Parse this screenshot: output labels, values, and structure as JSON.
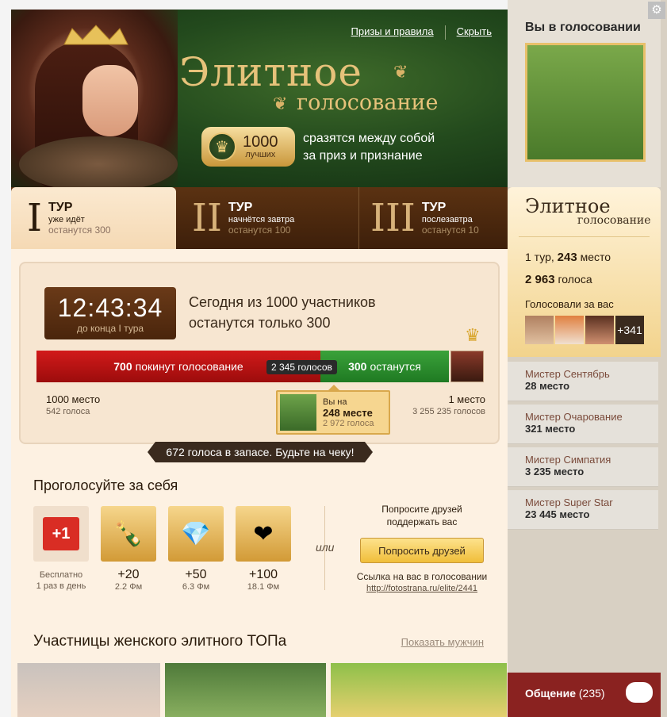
{
  "header": {
    "links": [
      "Призы и правила",
      "Скрыть"
    ],
    "logo_line1": "Элитное",
    "logo_line2": "голосование",
    "badge_num": "1000",
    "badge_sub": "лучших",
    "tagline1": "сразятся между собой",
    "tagline2": "за приз и признание"
  },
  "tours": [
    {
      "roman": "I",
      "title": "ТУР",
      "status": "уже идёт",
      "remain": "останутся 300"
    },
    {
      "roman": "II",
      "title": "ТУР",
      "status": "начнётся завтра",
      "remain": "останутся 100"
    },
    {
      "roman": "III",
      "title": "ТУР",
      "status": "послезавтра",
      "remain": "останутся 10"
    }
  ],
  "countdown": {
    "time": "12:43:34",
    "label": "до конца I тура",
    "text1": "Сегодня из 1000 участников",
    "text2": "останутся только 300"
  },
  "bar": {
    "left_num": "700",
    "left_text": "покинут голосование",
    "mid": "2 345 голосов",
    "right_num": "300",
    "right_text": "останутся",
    "red_fraction": 0.7
  },
  "rank_left": {
    "place": "1000 место",
    "votes": "542 голоса"
  },
  "rank_right": {
    "place": "1 место",
    "votes": "3 255 235 голосов"
  },
  "you": {
    "label": "Вы на",
    "place": "248 месте",
    "votes": "2 972 голоса"
  },
  "reserve": "672 голоса в запасе. Будьте на чеку!",
  "vote": {
    "title": "Проголосуйте за себя",
    "items": [
      {
        "badge": "+1",
        "line1": "Бесплатно",
        "line2": "1 раз в день",
        "icon": "plus-one-icon"
      },
      {
        "value": "+20",
        "price": "2.2 Фм",
        "icon": "champagne-icon"
      },
      {
        "value": "+50",
        "price": "6.3 Фм",
        "icon": "diamond-icon"
      },
      {
        "value": "+100",
        "price": "18.1 Фм",
        "icon": "heart-gem-icon"
      }
    ],
    "or": "или",
    "ask_text1": "Попросите друзей",
    "ask_text2": "поддержать вас",
    "ask_button": "Попросить друзей",
    "link_label": "Ссылка на вас в голосовании",
    "link_url": "http://fotostrana.ru/elite/2441"
  },
  "top": {
    "title": "Участницы женского элитного ТОПа",
    "show_men": "Показать мужчин"
  },
  "sidebar": {
    "title": "Вы в голосовании",
    "logo_line1": "Элитное",
    "logo_line2": "голосование",
    "tour_rank": "1 тур,",
    "tour_place": "243",
    "tour_place_suffix": "место",
    "votes_num": "2 963",
    "votes_suffix": "голоса",
    "voted_for": "Голосовали за вас",
    "more": "+341",
    "ratings": [
      {
        "name": "Мистер Сентябрь",
        "place": "28 место"
      },
      {
        "name": "Мистер Очарование",
        "place": "321 место"
      },
      {
        "name": "Мистер Симпатия",
        "place": "3 235 место"
      },
      {
        "name": "Мистер Super Star",
        "place": "23 445 место"
      }
    ],
    "chat_label": "Общение",
    "chat_count": "(235)"
  }
}
